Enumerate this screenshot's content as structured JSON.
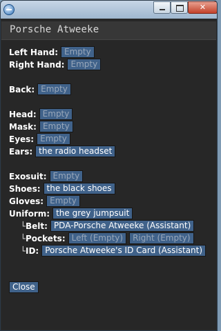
{
  "window": {
    "title_bar_text": ""
  },
  "header": {
    "title": "Porsche Atweeke"
  },
  "slots": {
    "left_hand": {
      "label": "Left Hand:",
      "value": "Empty"
    },
    "right_hand": {
      "label": "Right Hand:",
      "value": "Empty"
    },
    "back": {
      "label": "Back:",
      "value": "Empty"
    },
    "head": {
      "label": "Head:",
      "value": "Empty"
    },
    "mask": {
      "label": "Mask:",
      "value": "Empty"
    },
    "eyes": {
      "label": "Eyes:",
      "value": "Empty"
    },
    "ears": {
      "label": "Ears:",
      "value": "the radio headset"
    },
    "exosuit": {
      "label": "Exosuit:",
      "value": "Empty"
    },
    "shoes": {
      "label": "Shoes:",
      "value": "the black shoes"
    },
    "gloves": {
      "label": "Gloves:",
      "value": "Empty"
    },
    "uniform": {
      "label": "Uniform:",
      "value": "the grey jumpsuit"
    },
    "belt": {
      "mark": "└",
      "label": "Belt:",
      "value": "PDA-Porsche Atweeke (Assistant)"
    },
    "pockets": {
      "mark": "└",
      "label": "Pockets:",
      "left": "Left (Empty)",
      "right": "Right (Empty)"
    },
    "id": {
      "mark": "└",
      "label": "ID:",
      "value": "Porsche Atweeke's ID Card (Assistant)"
    }
  },
  "footer": {
    "close_label": "Close"
  },
  "colors": {
    "panel_bg": "#272727",
    "header_bg": "#373737",
    "chip_bg": "#40628a",
    "empty_text": "#98a7ba"
  },
  "icons": {
    "window_icon": "byond-globe-icon",
    "minimize": "minimize-icon",
    "maximize": "maximize-icon",
    "close": "close-icon"
  }
}
